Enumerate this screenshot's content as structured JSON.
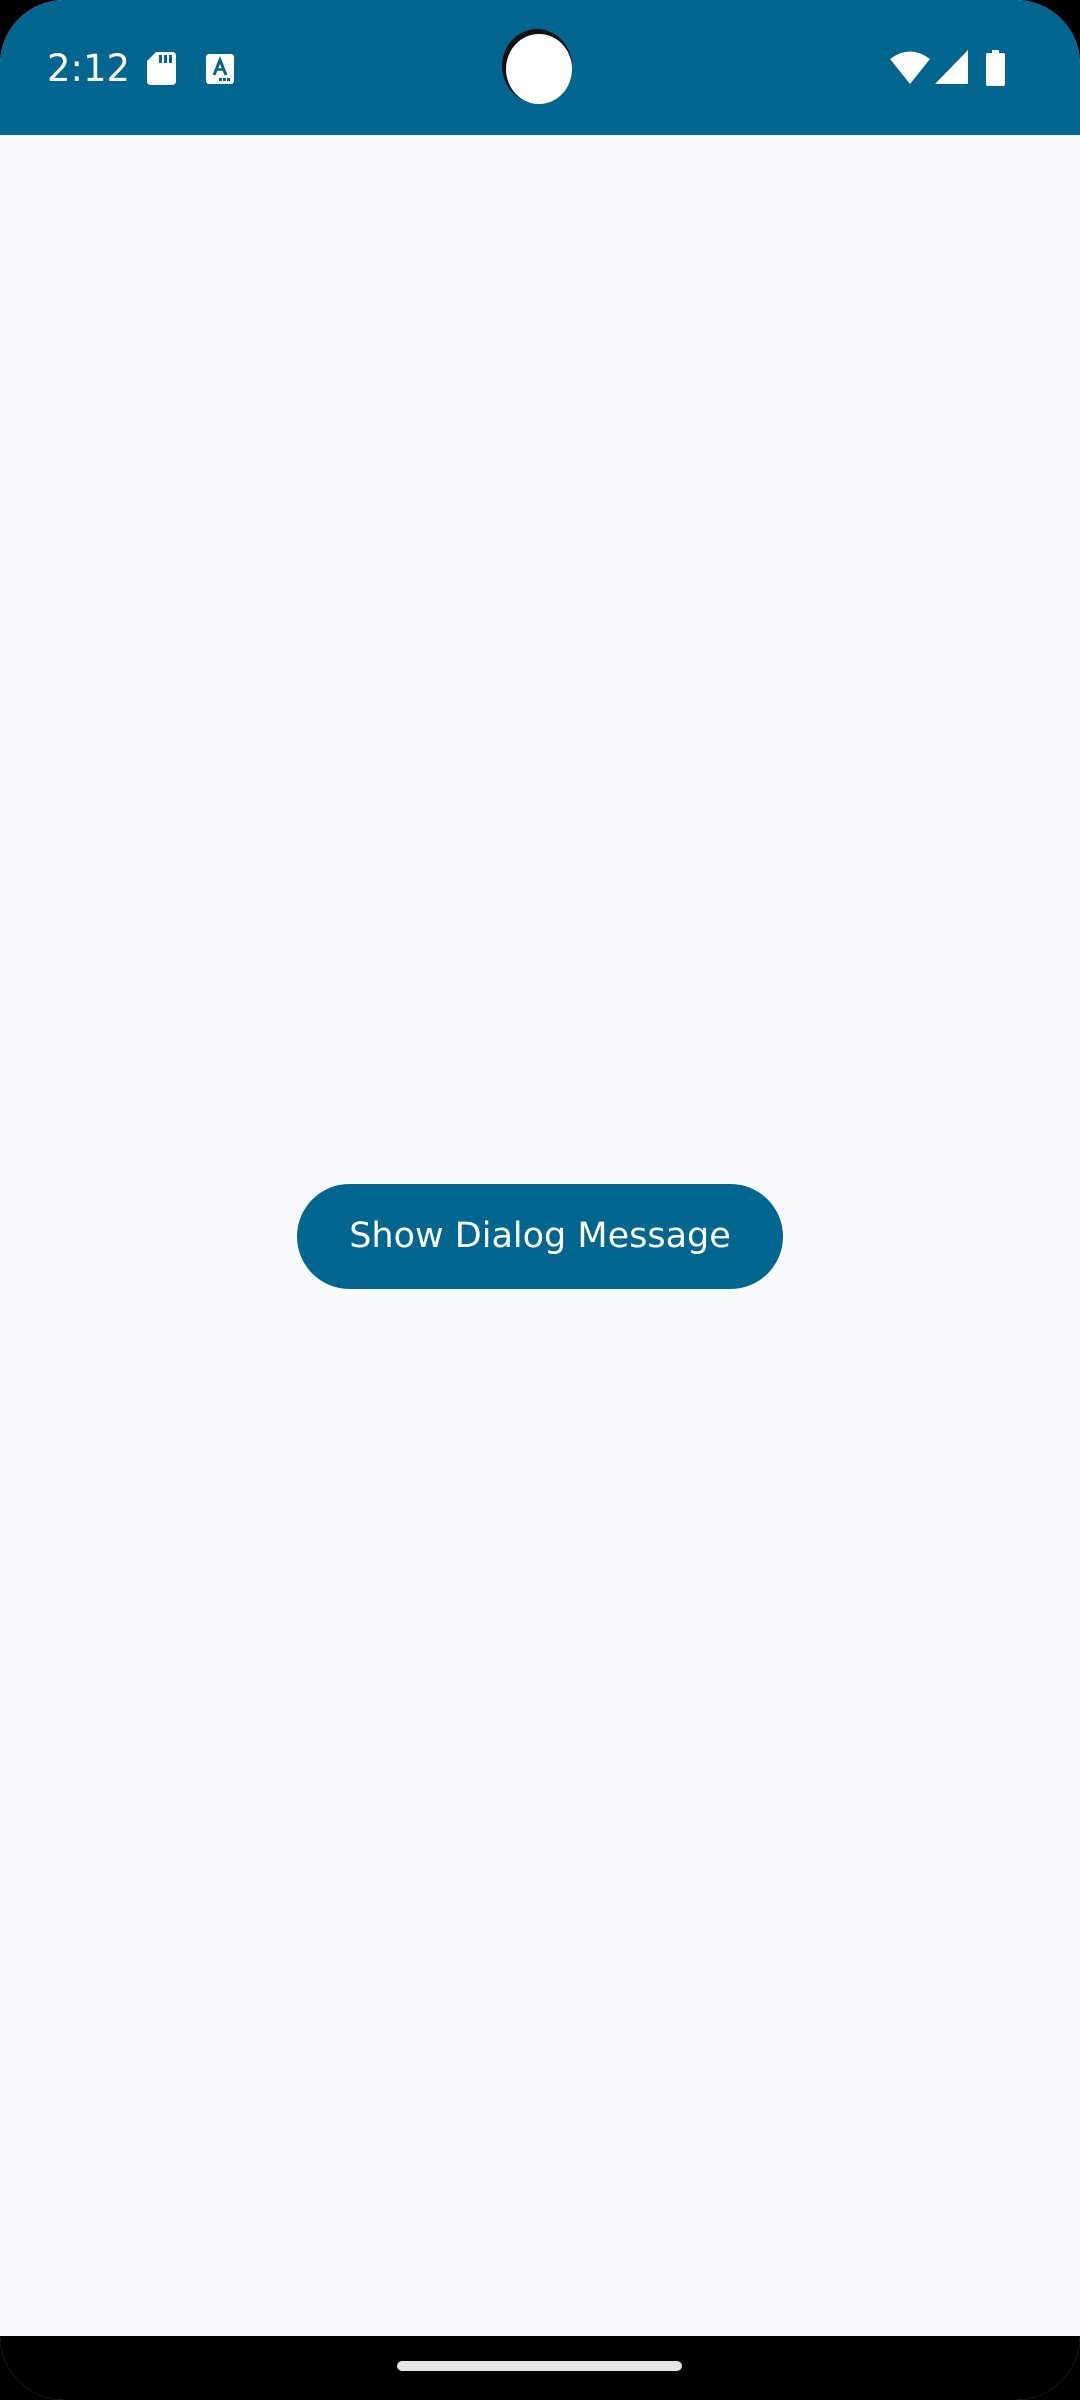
{
  "status_bar": {
    "time": "2:12",
    "background_color": "#00668f",
    "left_icons": [
      "sd-card-icon",
      "text-format-icon"
    ],
    "right_icons": [
      "wifi-icon",
      "cellular-signal-icon",
      "battery-icon"
    ]
  },
  "main": {
    "background_color": "#f9fafd",
    "show_dialog_button_label": "Show Dialog Message",
    "button_color": "#00668f"
  },
  "navigation_bar": {
    "home_handle": "gesture-handle"
  }
}
